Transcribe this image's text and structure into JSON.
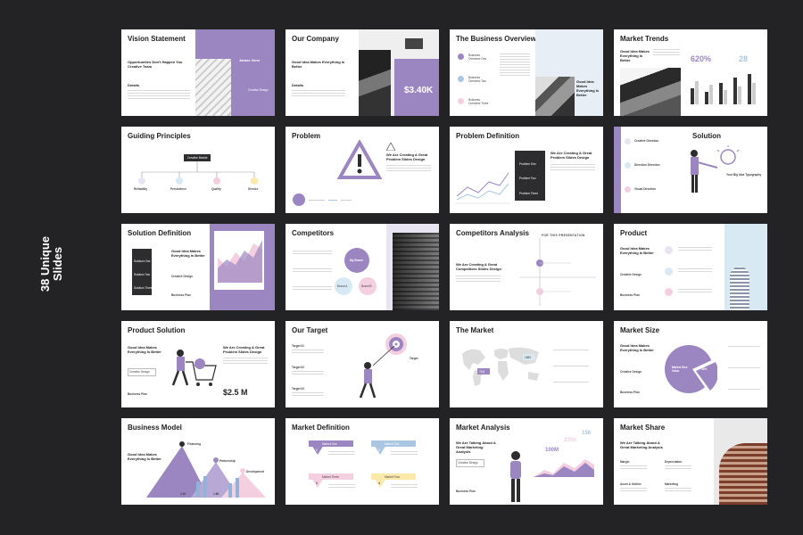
{
  "side_label": "38 Unique Slides",
  "slides": {
    "s1": {
      "title": "Vision Statement",
      "sub": "Opportunities Don't Happen You Creative Team",
      "label": "Details",
      "name": "James Venn",
      "role": "Creative Design"
    },
    "s2": {
      "title": "Our Company",
      "sub": "Good Idea Makes Everything Is Better",
      "label": "Details",
      "value": "$3.40K"
    },
    "s3": {
      "title": "The Business Overview",
      "items": [
        "Business Overview One",
        "Business Overview Two",
        "Business Overview Three"
      ],
      "sub": "Good Idea Makes Everything Is Better"
    },
    "s4": {
      "title": "Market Trends",
      "sub": "Good Idea Makes Everything Is Better",
      "v1": "620%",
      "v2": "28"
    },
    "s5": {
      "title": "Guiding Principles",
      "box": "Creative Beside",
      "items": [
        "Reliability",
        "Persistence",
        "Quality",
        "Service"
      ]
    },
    "s6": {
      "title": "Problem",
      "sub": "We Are Creating A Great Problem Slides Design"
    },
    "s7": {
      "title": "Problem Definition",
      "sub": "We Are Creating & Great Problem Slides Design",
      "items": [
        "Problem One",
        "Problem Two",
        "Problem Three"
      ]
    },
    "s8": {
      "title": "Solution",
      "items": [
        "Creative Direction",
        "Direction Direction",
        "Visual Direction"
      ],
      "note": "Your Big Idea Typography"
    },
    "s9": {
      "title": "Solution Definition",
      "sub": "Good Idea Makes Everything Is Better",
      "items": [
        "Solution One",
        "Solution Two",
        "Solution Three"
      ],
      "foot": "Business Plan",
      "label": "Creative Design"
    },
    "s10": {
      "title": "Competitors",
      "bubbles": [
        "My Brand",
        "Brand A",
        "Brand B"
      ]
    },
    "s11": {
      "title": "Competitors Analysis",
      "top": "FOR THIS PRESENTATION",
      "sub": "We Are Creating A Great Competitors Slides Design"
    },
    "s12": {
      "title": "Product",
      "sub": "Good Idea Makes Everything Is Better",
      "label": "Creative Design",
      "foot": "Business Plan"
    },
    "s13": {
      "title": "Product Solution",
      "sub": "Good Idea Makes Everything Is Better",
      "label": "Creative Design",
      "right": "We Are Creating & Great Problem Slides Design",
      "foot": "Business Plan",
      "value": "$2.5 M"
    },
    "s14": {
      "title": "Our Target",
      "targets": [
        "Target 01",
        "Target 02",
        "Target 03"
      ],
      "label": "Target"
    },
    "s15": {
      "title": "The Market",
      "tag1": "76.8",
      "tag2": "1880"
    },
    "s16": {
      "title": "Market Size",
      "sub": "Good Idea Makes Everything Is Better",
      "label": "Creative Design",
      "center": "Market Size Value",
      "pct": "40%",
      "foot": "Business Plan"
    },
    "s17": {
      "title": "Business Model",
      "sub": "Good Idea Makes Everything Is Better",
      "peaks": [
        "Financing",
        "Partnership",
        "Development"
      ],
      "values": [
        "3.3K",
        "1.8K"
      ]
    },
    "s18": {
      "title": "Market Definition",
      "steps": [
        "Market One",
        "Market Two",
        "Market Three",
        "Market Four"
      ],
      "nums": [
        "1",
        "2",
        "3",
        "4"
      ]
    },
    "s19": {
      "title": "Market Analysis",
      "sub": "We Are Talking About A Great Marketing Analysis",
      "label": "Creative Design",
      "foot": "Business Plan",
      "v1": "100M",
      "v2": "235K",
      "v3": "156"
    },
    "s20": {
      "title": "Market Share",
      "sub": "We Are Talking About A Great Marketing Analysis",
      "items": [
        "Margin",
        "Depreciation",
        "Asset & Outline",
        "Marketing"
      ]
    }
  }
}
